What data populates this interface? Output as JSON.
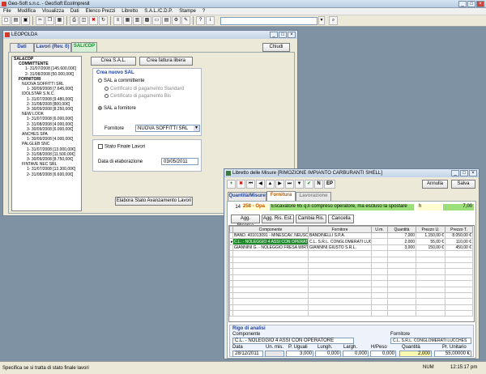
{
  "app": {
    "title": "Geo-Soft s.n.c. - GeoSoft EcoImpresit"
  },
  "menu": [
    "File",
    "Modifica",
    "Visualizza",
    "Dati",
    "Elenco Prezzi",
    "Libretto",
    "S.A.L./C.D.P.",
    "Stampe",
    "?"
  ],
  "statusbar": {
    "hint": "Specifica se si tratta di stato finale lavori",
    "num": "NUM",
    "time": "12:15:17 pm"
  },
  "leopolda": {
    "title": "LEOPOLDA",
    "tabs": [
      "Dati",
      "Lavori (Rev. 0)",
      "SAL/CDP"
    ],
    "close_label": "Chiudi",
    "buttons": {
      "crea_sal": "Crea S.A.L.",
      "crea_fattura": "Crea fattura libera",
      "elabora": "Elabora Stato Avanzamento Lavori"
    },
    "tree": [
      "SAL&CDP",
      "COMMITTENTE",
      "1- 31/07/2008 [145.600,00€]",
      "2- 31/08/2008 [50.000,00€]",
      "FORNITORI",
      "NUOVA SOFFITTI SRL",
      "1- 30/09/2008 [7.645,00€]",
      "IDOLSTAR S.N.C.",
      "1- 31/07/2008 [9.480,00€]",
      "2- 31/08/2008 [800,00€]",
      "3- 30/09/2008 [8.250,00€]",
      "NEW LOOK",
      "1- 31/07/2008 [6.000,00€]",
      "2- 31/08/2008 [4.000,00€]",
      "3- 30/09/2008 [6.000,00€]",
      "ANCHES SPA",
      "1- 30/09/2008 [4.000,00€]",
      "PALGLEB SNC",
      "1- 31/07/2008 [13.000,00€]",
      "2- 31/08/2008 [11.500,00€]",
      "3- 30/09/2008 [8.750,00€]",
      "FINTAVE NEC SRL",
      "1- 31/07/2008 [13.300,00€]",
      "2- 31/08/2008 [6.600,00€]"
    ],
    "nuovo_sal": {
      "legend": "Crea nuovo SAL",
      "opt_committente": "SAL a committente",
      "opt_standard": "Certificato di pagamento Standard",
      "opt_bis": "Certificato di pagamento Bis",
      "opt_fornitore": "SAL a fornitore",
      "fornitore_label": "Fornitore",
      "fornitore_value": "NUOVA SOFFITTI SRL"
    },
    "stato_finale": "Stato Finale Lavori",
    "data_label": "Data di elaborazione",
    "data_value": "03/05/2011"
  },
  "libretto": {
    "title": "Libretto delle Misure [RIMOZIONE IMPIANTO CARBURANTI SHELL]",
    "toolbar": [
      "N",
      "EP"
    ],
    "annulla": "Annulla",
    "salva": "Salva",
    "tabs": [
      "Quantità/Misure",
      "Fornitura",
      "Lavorazione"
    ],
    "code_num": "14",
    "code_id": "258 - Opa",
    "description": "Escavatore 65 q.li compreso operatore, ma escluso la spostare",
    "unit": "h",
    "qty_total": "7,00",
    "actions": [
      "Agg. Risorsa",
      "Agg. Ris. Est.",
      "Cambia Ris.",
      "Cancella"
    ],
    "columns": [
      "Componente",
      "Fornitore",
      "U.m.",
      "Quantità",
      "Prezzo U.",
      "Prezzo T."
    ],
    "rows": [
      {
        "comp": "BAND. 401013091 - MINESCAV. NEUSON",
        "forn": "BANDINELLI S.P.A.",
        "um": "",
        "qta": "7,000",
        "pu": "1.150,00 €",
        "pt": "8.050,00 €"
      },
      {
        "comp": "C.L. - NOLEGGIO 4 ASSI CON OPERATORE",
        "forn": "C.L. S.R.L. CONGLOMERATI LUCCHES",
        "um": "",
        "qta": "2,000",
        "pu": "55,00 €",
        "pt": "110,00 €"
      },
      {
        "comp": "GIANNINI G. - NOLEGGIO FRESA WIRTGH",
        "forn": "GIANNINI GIUSTO S.R.L.",
        "um": "",
        "qta": "3,000",
        "pu": "150,00 €",
        "pt": "450,00 €"
      }
    ],
    "rigo": {
      "legend": "Rigo di analisi",
      "componente_label": "Componente",
      "componente_value": "C.L. - NOLEGGIO 4 ASSI CON OPERATORE",
      "fornitore_label": "Fornitore",
      "fornitore_value": "C.L. S.R.L. CONGLOMERATI LUCCHES",
      "labels": [
        "Data",
        "Un. mis.",
        "P. Uguali",
        "Lungh.",
        "Largh.",
        "H/Peso",
        "Quantità",
        "Pr. Unitario"
      ],
      "values": [
        "28/12/2011",
        "",
        "3,000",
        "0,000",
        "0,000",
        "0,000",
        "2,000",
        "55,00000 €"
      ]
    }
  }
}
